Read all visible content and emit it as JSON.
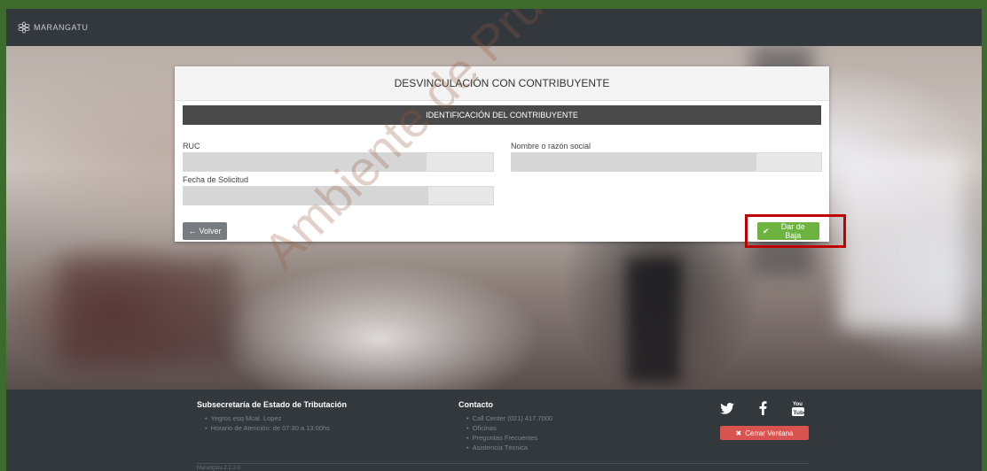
{
  "header": {
    "brand": "MARANGATU",
    "logo_icon": "flower-logo-icon"
  },
  "watermark": "Ambiente de Pruebas",
  "card": {
    "title": "DESVINCULACIÓN CON CONTRIBUYENTE",
    "section_title": "IDENTIFICACIÓN DEL CONTRIBUYENTE",
    "fields": {
      "ruc_label": "RUC",
      "ruc_value": "",
      "nombre_label": "Nombre o razón social",
      "nombre_value": "",
      "fecha_label": "Fecha de Solicitud",
      "fecha_value": ""
    },
    "back_button": "Volver",
    "back_icon": "arrow-left-icon",
    "submit_button": "Dar de Baja",
    "submit_icon": "check-icon"
  },
  "footer": {
    "org_title": "Subsecretaría de Estado de Tributación",
    "org_items": [
      "Yegros esq Mcal. Lopez",
      "Horario de Atención: de 07:30 a 13:00hs"
    ],
    "contact_title": "Contacto",
    "contact_items": [
      "Call Center (021) 417 7000",
      "Oficinas",
      "Preguntas Frecuentes",
      "Asistencia Técnica"
    ],
    "social_icons": [
      "twitter-icon",
      "facebook-icon",
      "youtube-icon"
    ],
    "close_button": "Cerrar Ventana",
    "close_icon": "x-icon",
    "version": "Marangatu 2.1.1.0"
  },
  "colors": {
    "submit": "#6cb33f",
    "close": "#d9534f",
    "highlight": "#c00000",
    "section_bar": "#4a4a4a",
    "topbar": "#33383d"
  }
}
